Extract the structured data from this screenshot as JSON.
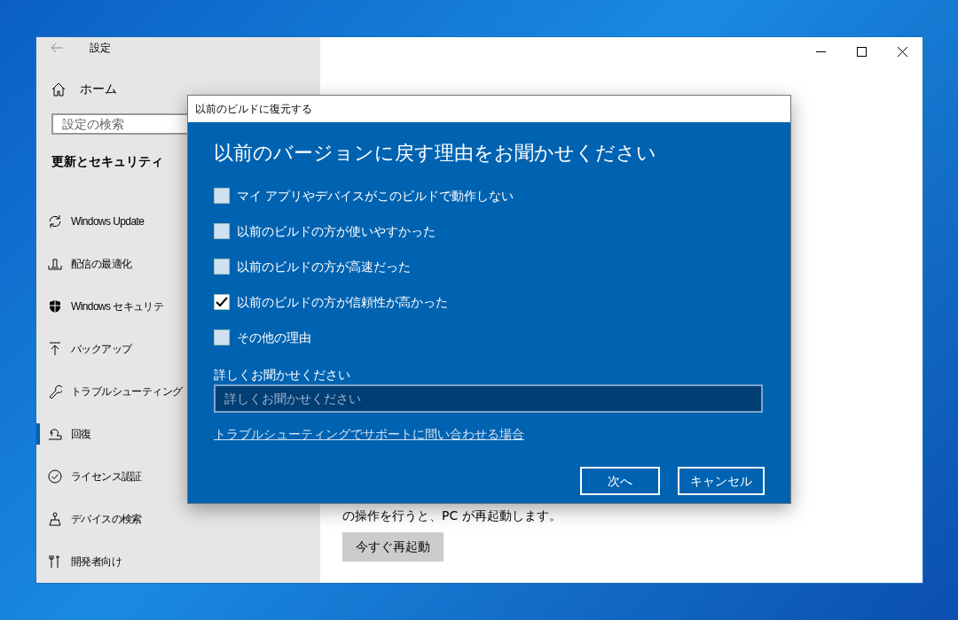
{
  "window": {
    "title": "設定"
  },
  "sidebar": {
    "home": "ホーム",
    "search": {
      "placeholder": "設定の検索"
    },
    "section": "更新とセキュリティ",
    "items": [
      {
        "label": "Windows Update",
        "selected": false
      },
      {
        "label": "配信の最適化",
        "selected": false
      },
      {
        "label": "Windows セキュリテ",
        "selected": false
      },
      {
        "label": "バックアップ",
        "selected": false
      },
      {
        "label": "トラブルシューティング",
        "selected": false
      },
      {
        "label": "回復",
        "selected": true
      },
      {
        "label": "ライセンス認証",
        "selected": false
      },
      {
        "label": "デバイスの検索",
        "selected": false
      },
      {
        "label": "開発者向け",
        "selected": false
      }
    ]
  },
  "main": {
    "restart_note": "の操作を行うと、PC が再起動します。",
    "restart_button": "今すぐ再起動"
  },
  "dialog": {
    "title": "以前のビルドに復元する",
    "heading": "以前のバージョンに戻す理由をお聞かせください",
    "reasons": [
      {
        "label": "マイ アプリやデバイスがこのビルドで動作しない",
        "checked": false
      },
      {
        "label": "以前のビルドの方が使いやすかった",
        "checked": false
      },
      {
        "label": "以前のビルドの方が高速だった",
        "checked": false
      },
      {
        "label": "以前のビルドの方が信頼性が高かった",
        "checked": true
      },
      {
        "label": "その他の理由",
        "checked": false
      }
    ],
    "details_label": "詳しくお聞かせください",
    "details": {
      "placeholder": "詳しくお聞かせください"
    },
    "link": "トラブルシューティングでサポートに問い合わせる場合",
    "buttons": [
      "次へ",
      "キャンセル"
    ]
  }
}
